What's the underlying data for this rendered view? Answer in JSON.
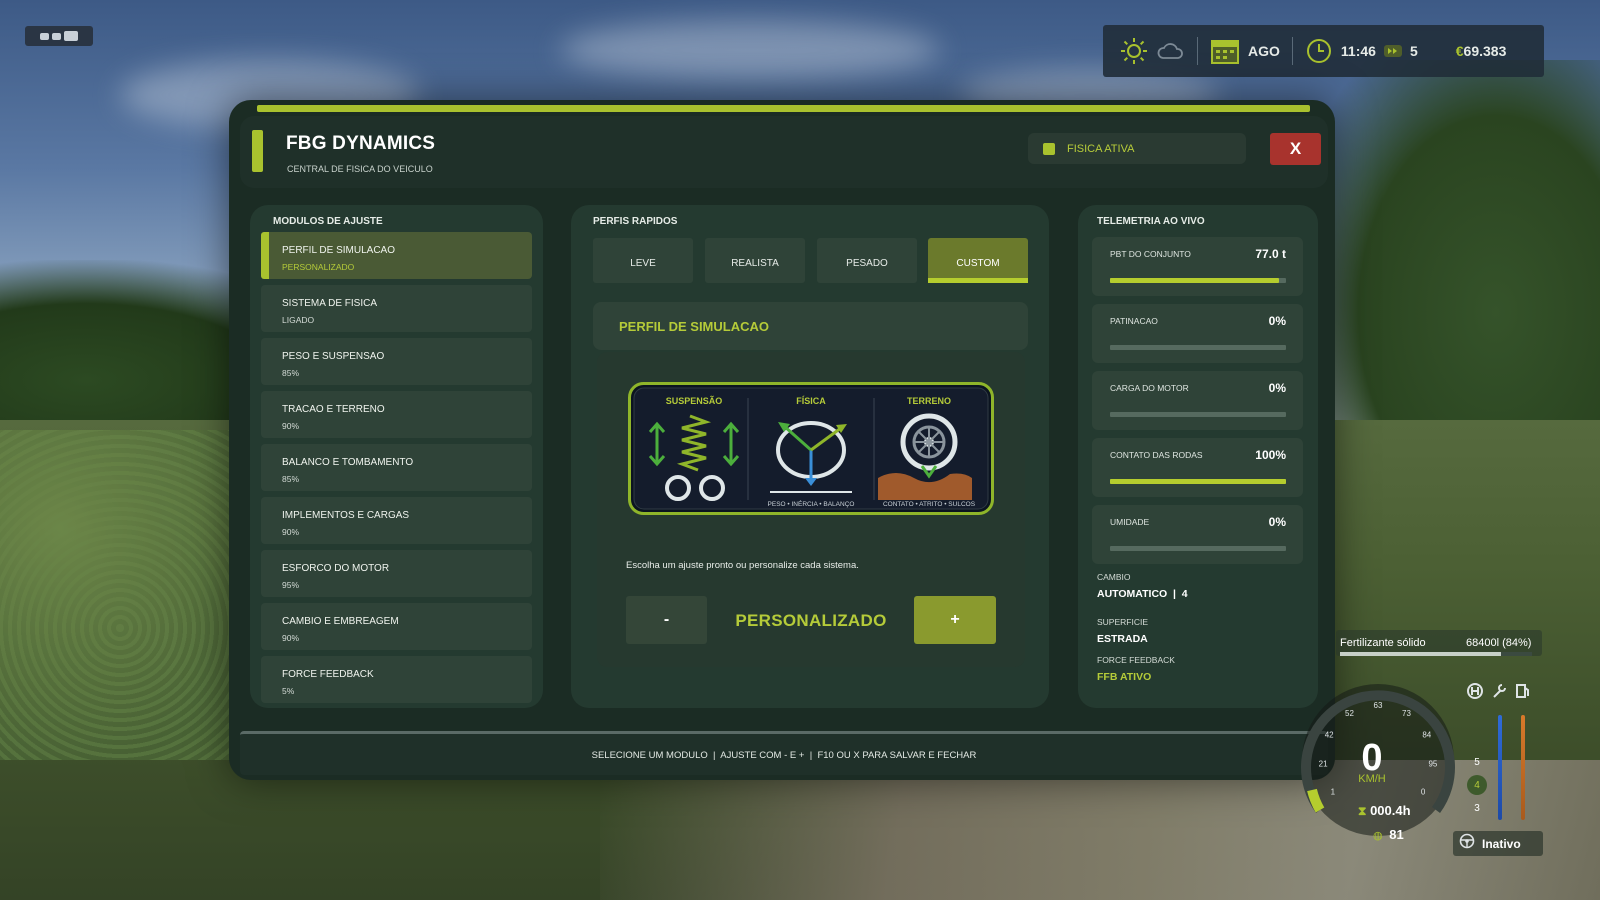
{
  "hud_top": {
    "weather_icons": [
      "sun-icon",
      "cloud-icon"
    ],
    "month": "AGO",
    "time": "11:46",
    "speed_multiplier": "5",
    "money": "69.383"
  },
  "header": {
    "title": "FBG DYNAMICS",
    "subtitle": "CENTRAL DE FISICA DO VEICULO",
    "status": "FISICA ATIVA",
    "close_label": "X"
  },
  "modules": {
    "heading": "MODULOS DE AJUSTE",
    "items": [
      {
        "label": "PERFIL DE SIMULACAO",
        "value": "PERSONALIZADO"
      },
      {
        "label": "SISTEMA DE FISICA",
        "value": "LIGADO"
      },
      {
        "label": "PESO E SUSPENSAO",
        "value": "85%"
      },
      {
        "label": "TRACAO E TERRENO",
        "value": "90%"
      },
      {
        "label": "BALANCO E TOMBAMENTO",
        "value": "85%"
      },
      {
        "label": "IMPLEMENTOS E CARGAS",
        "value": "90%"
      },
      {
        "label": "ESFORCO DO MOTOR",
        "value": "95%"
      },
      {
        "label": "CAMBIO E EMBREAGEM",
        "value": "90%"
      },
      {
        "label": "FORCE FEEDBACK",
        "value": "5%"
      }
    ]
  },
  "profiles": {
    "heading": "PERFIS RAPIDOS",
    "tabs": [
      "LEVE",
      "REALISTA",
      "PESADO",
      "CUSTOM"
    ],
    "active_tab": "CUSTOM",
    "section_title": "PERFIL DE SIMULACAO",
    "diagram": {
      "labels": [
        "SUSPENSÃO",
        "FÍSICA",
        "TERRENO"
      ],
      "caption_physics": "PESO • INÉRCIA • BALANÇO",
      "caption_terrain": "CONTATO • ATRITO • SULCOS"
    },
    "hint": "Escolha um ajuste pronto ou personalize cada sistema.",
    "stepper": {
      "minus": "-",
      "value": "PERSONALIZADO",
      "plus": "+"
    }
  },
  "telemetry": {
    "heading": "TELEMETRIA AO VIVO",
    "items": [
      {
        "label": "PBT DO CONJUNTO",
        "value": "77.0 t",
        "fill": 0.96
      },
      {
        "label": "PATINACAO",
        "value": "0%",
        "fill": 0
      },
      {
        "label": "CARGA DO MOTOR",
        "value": "0%",
        "fill": 0
      },
      {
        "label": "CONTATO DAS RODAS",
        "value": "100%",
        "fill": 1.0
      },
      {
        "label": "UMIDADE",
        "value": "0%",
        "fill": 0
      }
    ],
    "gearbox_label": "CAMBIO",
    "gearbox_value": "AUTOMATICO  |  4",
    "surface_label": "SUPERFICIE",
    "surface_value": "ESTRADA",
    "ffb_label": "FORCE FEEDBACK",
    "ffb_value": "FFB ATIVO"
  },
  "footer": {
    "text": "SELECIONE UM MODULO  |  AJUSTE COM - E +  |  F10 OU X PARA SALVAR E FECHAR"
  },
  "vehicle_hud": {
    "fill_label": "Fertilizante sólido",
    "fill_value": "68400l (84%)",
    "fill_fraction": 0.84,
    "speed": "0",
    "speed_unit": "KM/H",
    "hours": "000.4h",
    "fuel": "81",
    "gears": [
      "5",
      "4",
      "3"
    ],
    "active_gear": "4",
    "gauge_ticks": [
      "1",
      "21",
      "42",
      "52",
      "63",
      "73",
      "84",
      "95",
      "0"
    ],
    "status": "Inativo"
  },
  "colors": {
    "accent": "#a9c22e",
    "panel": "#1b2c24",
    "close": "#a8332d"
  }
}
